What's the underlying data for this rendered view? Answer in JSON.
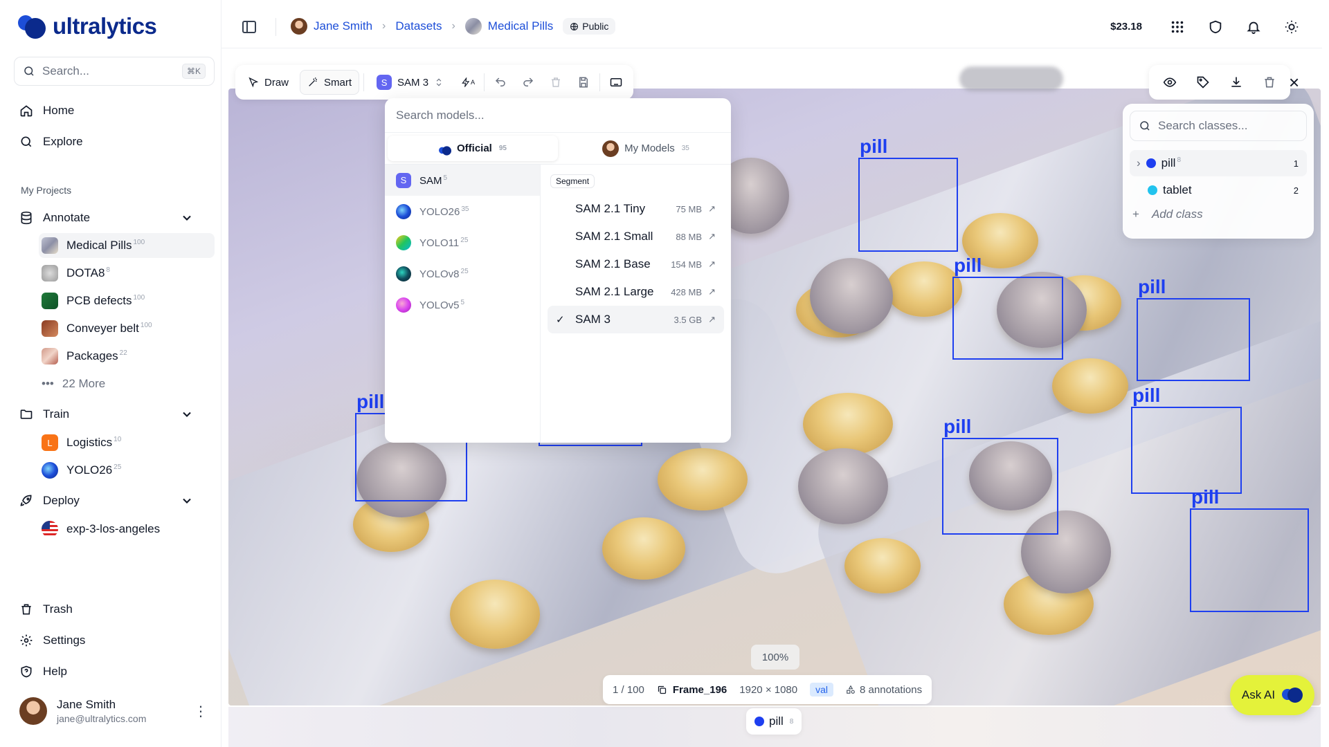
{
  "brand": {
    "name": "ultralytics"
  },
  "sidebar": {
    "search_placeholder": "Search...",
    "search_shortcut": "⌘K",
    "home": "Home",
    "explore": "Explore",
    "section_label": "My Projects",
    "annotate": {
      "label": "Annotate",
      "items": [
        {
          "label": "Medical Pills",
          "count": "100"
        },
        {
          "label": "DOTA8",
          "count": "8"
        },
        {
          "label": "PCB defects",
          "count": "100"
        },
        {
          "label": "Conveyer belt",
          "count": "100"
        },
        {
          "label": "Packages",
          "count": "22"
        },
        {
          "label": "22 More",
          "count": ""
        }
      ]
    },
    "train": {
      "label": "Train",
      "items": [
        {
          "label": "Logistics",
          "count": "10"
        },
        {
          "label": "YOLO26",
          "count": "25"
        }
      ]
    },
    "deploy": {
      "label": "Deploy",
      "items": [
        {
          "label": "exp-3-los-angeles"
        }
      ]
    },
    "trash": "Trash",
    "settings": "Settings",
    "help": "Help",
    "user": {
      "name": "Jane Smith",
      "email": "jane@ultralytics.com"
    }
  },
  "topbar": {
    "breadcrumbs": [
      "Jane Smith",
      "Datasets",
      "Medical Pills"
    ],
    "visibility": "Public",
    "credits": "$23.18"
  },
  "toolbar": {
    "draw": "Draw",
    "smart": "Smart",
    "model": "SAM 3",
    "model_badge": "S",
    "auto_label": "A"
  },
  "model_dropdown": {
    "search_placeholder": "Search models...",
    "tabs": [
      {
        "label": "Official",
        "count": "95"
      },
      {
        "label": "My Models",
        "count": "35"
      }
    ],
    "families": [
      {
        "label": "SAM",
        "count": "5",
        "badge": "S"
      },
      {
        "label": "YOLO26",
        "count": "35"
      },
      {
        "label": "YOLO11",
        "count": "25"
      },
      {
        "label": "YOLOv8",
        "count": "25"
      },
      {
        "label": "YOLOv5",
        "count": "5"
      }
    ],
    "task": "Segment",
    "variants": [
      {
        "label": "SAM 2.1 Tiny",
        "size": "75 MB"
      },
      {
        "label": "SAM 2.1 Small",
        "size": "88 MB"
      },
      {
        "label": "SAM 2.1 Base",
        "size": "154 MB"
      },
      {
        "label": "SAM 2.1 Large",
        "size": "428 MB"
      },
      {
        "label": "SAM 3",
        "size": "3.5 GB"
      }
    ],
    "check": "✓",
    "ext": "↗"
  },
  "classes": {
    "search_placeholder": "Search classes...",
    "items": [
      {
        "label": "pill",
        "count": "8",
        "total": "1",
        "color": "#1e3ff0"
      },
      {
        "label": "tablet",
        "count": "",
        "total": "2",
        "color": "#22c3ee"
      }
    ],
    "add_label": "Add class"
  },
  "canvas": {
    "box_label": "pill",
    "zoom": "100%",
    "position": "1 / 100",
    "frame": "Frame_196",
    "resolution": "1920 × 1080",
    "split": "val",
    "annotations": "8 annotations"
  },
  "footer_class": {
    "label": "pill",
    "count": "8"
  },
  "ask_ai": "Ask AI"
}
